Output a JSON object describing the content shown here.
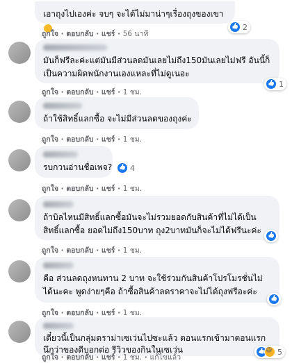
{
  "comments": [
    {
      "text_lines": [
        "เอาถุงไปเองค่ะ จบๆ จะได้ไม่มาน่าๆเรื่องถุงของเขา"
      ],
      "has_emoji": true,
      "actions": {
        "like": "ถูกใจ",
        "reply": "ตอบกลับ",
        "share": "แชร์",
        "time": "56 นาที"
      },
      "reaction": {
        "icons": [
          "like-icon"
        ],
        "count": "2"
      }
    },
    {
      "text_lines": [
        "มันก็ฟรีละค่ะแต่มันมีส่วนลดมันเลยไม่ถึง150มันเลยไม่ฟรี อันนี้ก็",
        "เป็นความผิดพนักงานเองแหละที่ไม่ดูเนอะ"
      ],
      "actions": {
        "like": "ถูกใจ",
        "reply": "ตอบกลับ",
        "share": "แชร์",
        "time": "1 ชม."
      },
      "reaction": {
        "icons": [
          "like-icon"
        ],
        "count": "1"
      }
    },
    {
      "text_lines": [
        "ถ้าใช้สิทธิ์แลกซื้อ จะไม่มีส่วนลดของถุงค่ะ"
      ],
      "actions": {
        "like": "ถูกใจ",
        "reply": "ตอบกลับ",
        "share": "แชร์",
        "time": "1 ชม."
      }
    },
    {
      "text_lines": [
        "รบกวนอ่านชื่อเพจ?"
      ],
      "actions": {
        "like": "ถูกใจ",
        "reply": "ตอบกลับ",
        "share": "แชร์",
        "time": "1 ชม."
      },
      "reaction": {
        "icons": [
          "like-icon"
        ],
        "count": "4"
      }
    },
    {
      "text_lines": [
        "ถ้าบิลไหนมีสิทธิ์แลกซื้อมันจะไม่รวมยอดกับสินค้าที่ไม่ได้เป็น",
        "สิทธิ์แลกซื้อ ยอดไม่ถึง150บาท ถุง2บาทมันก็จะไม่ได้ฟรีนะค่ะ"
      ],
      "actions": {
        "like": "ถูกใจ",
        "reply": "ตอบกลับ",
        "share": "แชร์",
        "time": "1 ชม."
      },
      "reaction": {
        "icons": [
          "like-icon"
        ],
        "count": ""
      }
    },
    {
      "text_lines": [
        "คือ ส่วนลดถุงหนทาน 2 บาท จะใช้ร่วมกันสินค้าโปรโมรชั่นไม่",
        "ได้นะคะ พูดง่ายๆคือ ถ้าซื้อสินค้าลดราคาจะไม่ได้ถุงฟรีอะค่ะ"
      ],
      "actions": {
        "like": "ถูกใจ",
        "reply": "ตอบกลับ",
        "share": "แชร์",
        "time": "1 ชม."
      },
      "reaction": {
        "icons": [
          "like-icon"
        ],
        "count": ""
      }
    },
    {
      "text_lines": [
        "เดี๋ยวนี้เป็นกลุ่มดราม่าเซเว่นไปซะแล้ว ตอนแรกเข้ามาตอนแรก",
        "นึกว่าของดีบอกต่อ รีวิวของกินในเซเว่น"
      ],
      "actions": {
        "like": "ถูกใจ",
        "reply": "ตอบกลับ",
        "share": "แชร์",
        "time": "1 ชม.",
        "edited": "แก้ไขแล้ว"
      },
      "reaction": {
        "icons": [
          "like-icon",
          "haha-icon"
        ],
        "count": "5"
      }
    }
  ],
  "colors": {
    "bubble": "#f0f2f5",
    "meta": "#65676b",
    "like": "#1877f2",
    "haha": "#f7b125"
  }
}
